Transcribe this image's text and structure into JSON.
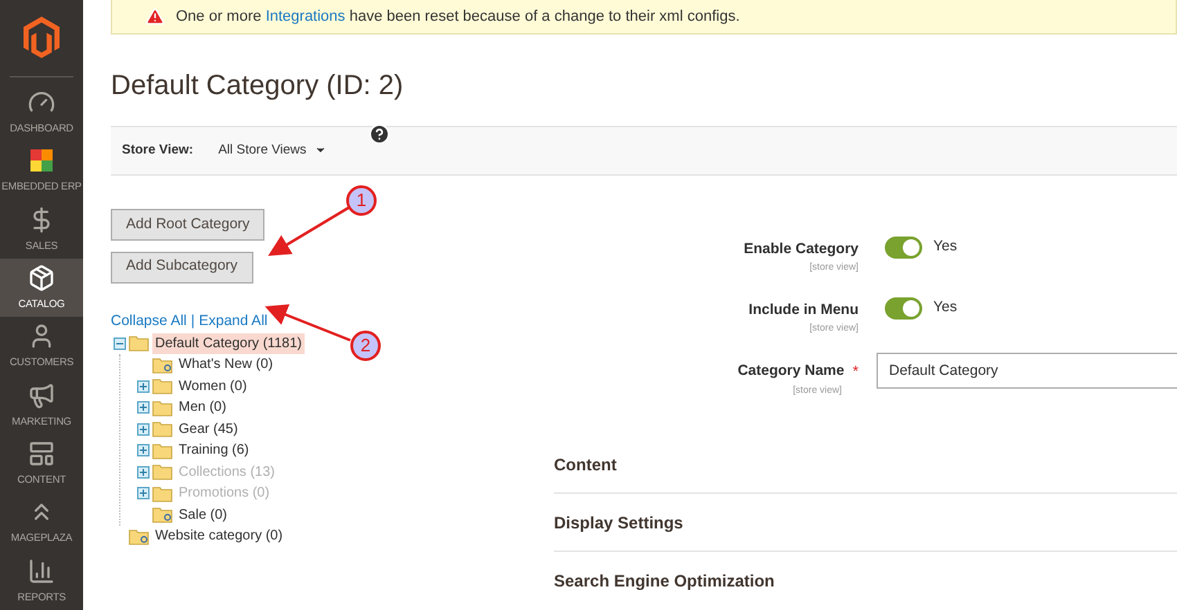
{
  "sidebar": {
    "items": [
      {
        "label": "DASHBOARD",
        "selected": false
      },
      {
        "label": "EMBEDDED ERP",
        "selected": false
      },
      {
        "label": "SALES",
        "selected": false
      },
      {
        "label": "CATALOG",
        "selected": true
      },
      {
        "label": "CUSTOMERS",
        "selected": false
      },
      {
        "label": "MARKETING",
        "selected": false
      },
      {
        "label": "CONTENT",
        "selected": false
      },
      {
        "label": "MAGEPLAZA",
        "selected": false
      },
      {
        "label": "REPORTS",
        "selected": false
      }
    ]
  },
  "notice": {
    "text_before": "One or more",
    "link": "Integrations",
    "text_after": "have been reset because of a change to their xml configs."
  },
  "page_title": "Default Category (ID: 2)",
  "store_view": {
    "label": "Store View:",
    "value": "All Store Views"
  },
  "buttons": [
    "Add Root Category",
    "Add Subcategory"
  ],
  "tree_links": {
    "collapse": "Collapse All",
    "separator": "|",
    "expand": "Expand All"
  },
  "tree": [
    {
      "label": "Default Category (1181)",
      "kind": "expandable",
      "expanded": true,
      "selected": true,
      "disabled": false,
      "children": [
        {
          "label": "What's New (0)",
          "kind": "leaf",
          "selected": false,
          "disabled": false
        },
        {
          "label": "Women (0)",
          "kind": "expandable",
          "expanded": false,
          "selected": false,
          "disabled": false
        },
        {
          "label": "Men (0)",
          "kind": "expandable",
          "expanded": false,
          "selected": false,
          "disabled": false
        },
        {
          "label": "Gear (45)",
          "kind": "expandable",
          "expanded": false,
          "selected": false,
          "disabled": false
        },
        {
          "label": "Training (6)",
          "kind": "expandable",
          "expanded": false,
          "selected": false,
          "disabled": false
        },
        {
          "label": "Collections (13)",
          "kind": "expandable",
          "expanded": false,
          "selected": false,
          "disabled": true
        },
        {
          "label": "Promotions (0)",
          "kind": "expandable",
          "expanded": false,
          "selected": false,
          "disabled": true
        },
        {
          "label": "Sale (0)",
          "kind": "leaf",
          "selected": false,
          "disabled": false
        }
      ]
    },
    {
      "label": "Website category (0)",
      "kind": "leaf",
      "selected": false,
      "disabled": false
    }
  ],
  "form": [
    {
      "kind": "toggle",
      "label": "Enable Category",
      "scope": "[store view]",
      "on": true,
      "value": "Yes"
    },
    {
      "kind": "toggle",
      "label": "Include in Menu",
      "scope": "[store view]",
      "on": true,
      "value": "Yes"
    },
    {
      "kind": "text",
      "label": "Category Name",
      "scope": "[store view]",
      "required_mark": "*",
      "value": "Default Category"
    }
  ],
  "sections": [
    "Content",
    "Display Settings",
    "Search Engine Optimization"
  ],
  "annotations": [
    {
      "number": "1"
    },
    {
      "number": "2"
    }
  ]
}
